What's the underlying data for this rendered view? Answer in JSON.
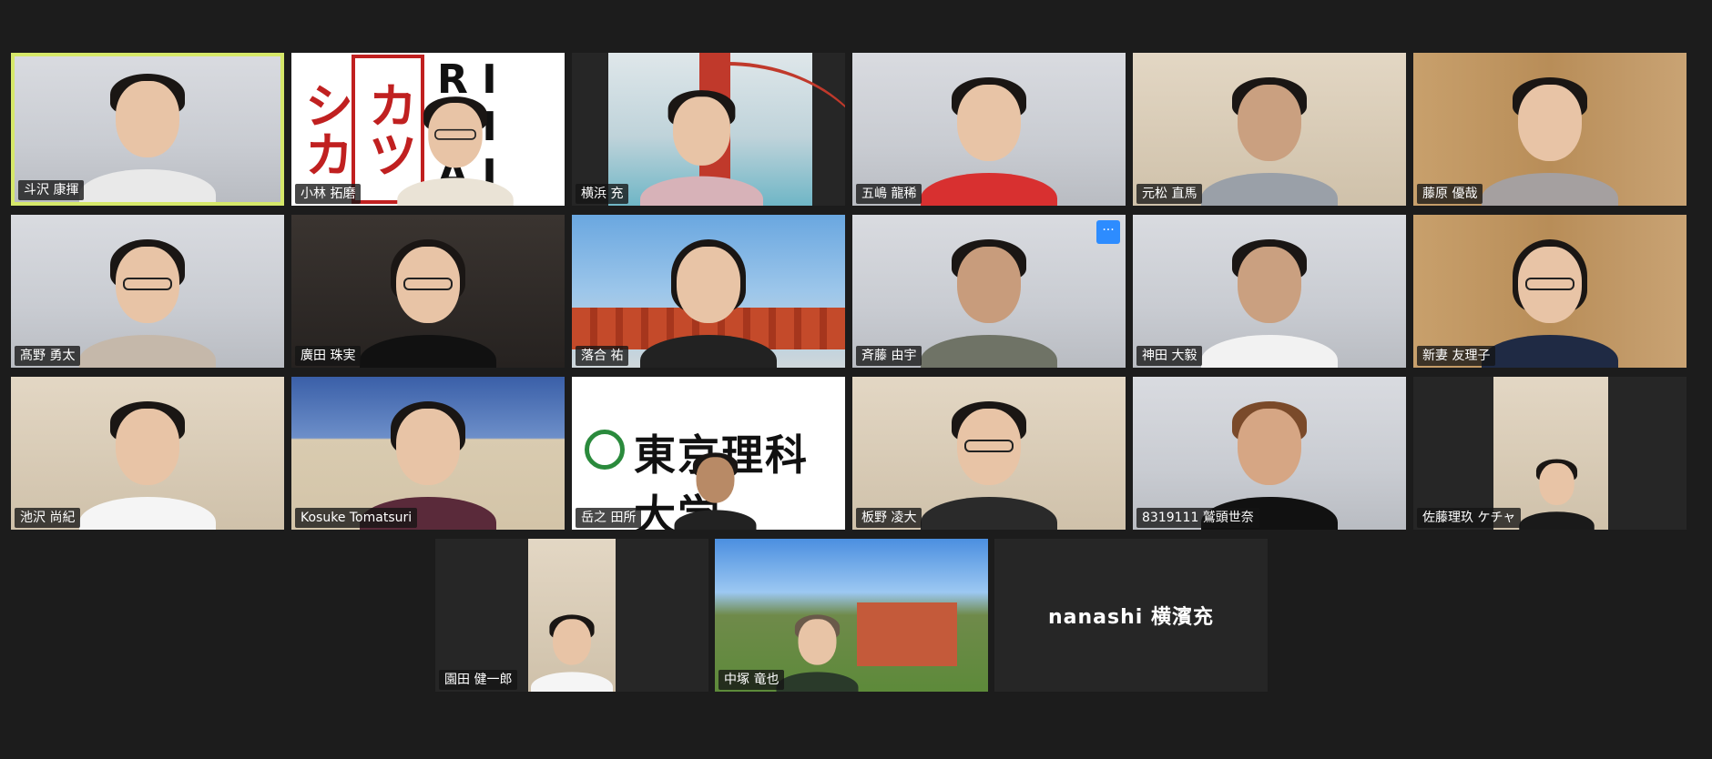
{
  "participants": [
    {
      "name": "斗沢 康揮",
      "active": true
    },
    {
      "name": "小林 拓磨",
      "bg": "rikadai"
    },
    {
      "name": "横浜 充",
      "bg": "bridge"
    },
    {
      "name": "五嶋 龍稀"
    },
    {
      "name": "元松 直馬"
    },
    {
      "name": "藤原 優哉"
    },
    {
      "name": "髙野 勇太"
    },
    {
      "name": "廣田 珠実"
    },
    {
      "name": "落合 祐",
      "bg": "shrine"
    },
    {
      "name": "斉藤 由宇",
      "more": "···"
    },
    {
      "name": "神田 大毅"
    },
    {
      "name": "新妻 友理子"
    },
    {
      "name": "池沢 尚紀"
    },
    {
      "name": "Kosuke Tomatsuri"
    },
    {
      "name": "岳之 田所",
      "bg": "tus"
    },
    {
      "name": "板野 凌大"
    },
    {
      "name": "8319111 鷲頭世奈"
    },
    {
      "name": "佐藤理玖  ケチャ"
    },
    {
      "name": "園田 健一郎"
    },
    {
      "name": "中塚 竜也",
      "bg": "outdoor"
    },
    {
      "name": "nanashi   横濱充",
      "video_off": true
    }
  ],
  "backgrounds": {
    "rikadai": {
      "seal_text": "カツシカ",
      "letters": "R I\nA I\nA I"
    },
    "tus": {
      "logo_text": "東京理科大学"
    }
  },
  "colors": {
    "active_border": "#d6e86a",
    "more_button": "#2d8cff",
    "background": "#1c1c1c"
  }
}
